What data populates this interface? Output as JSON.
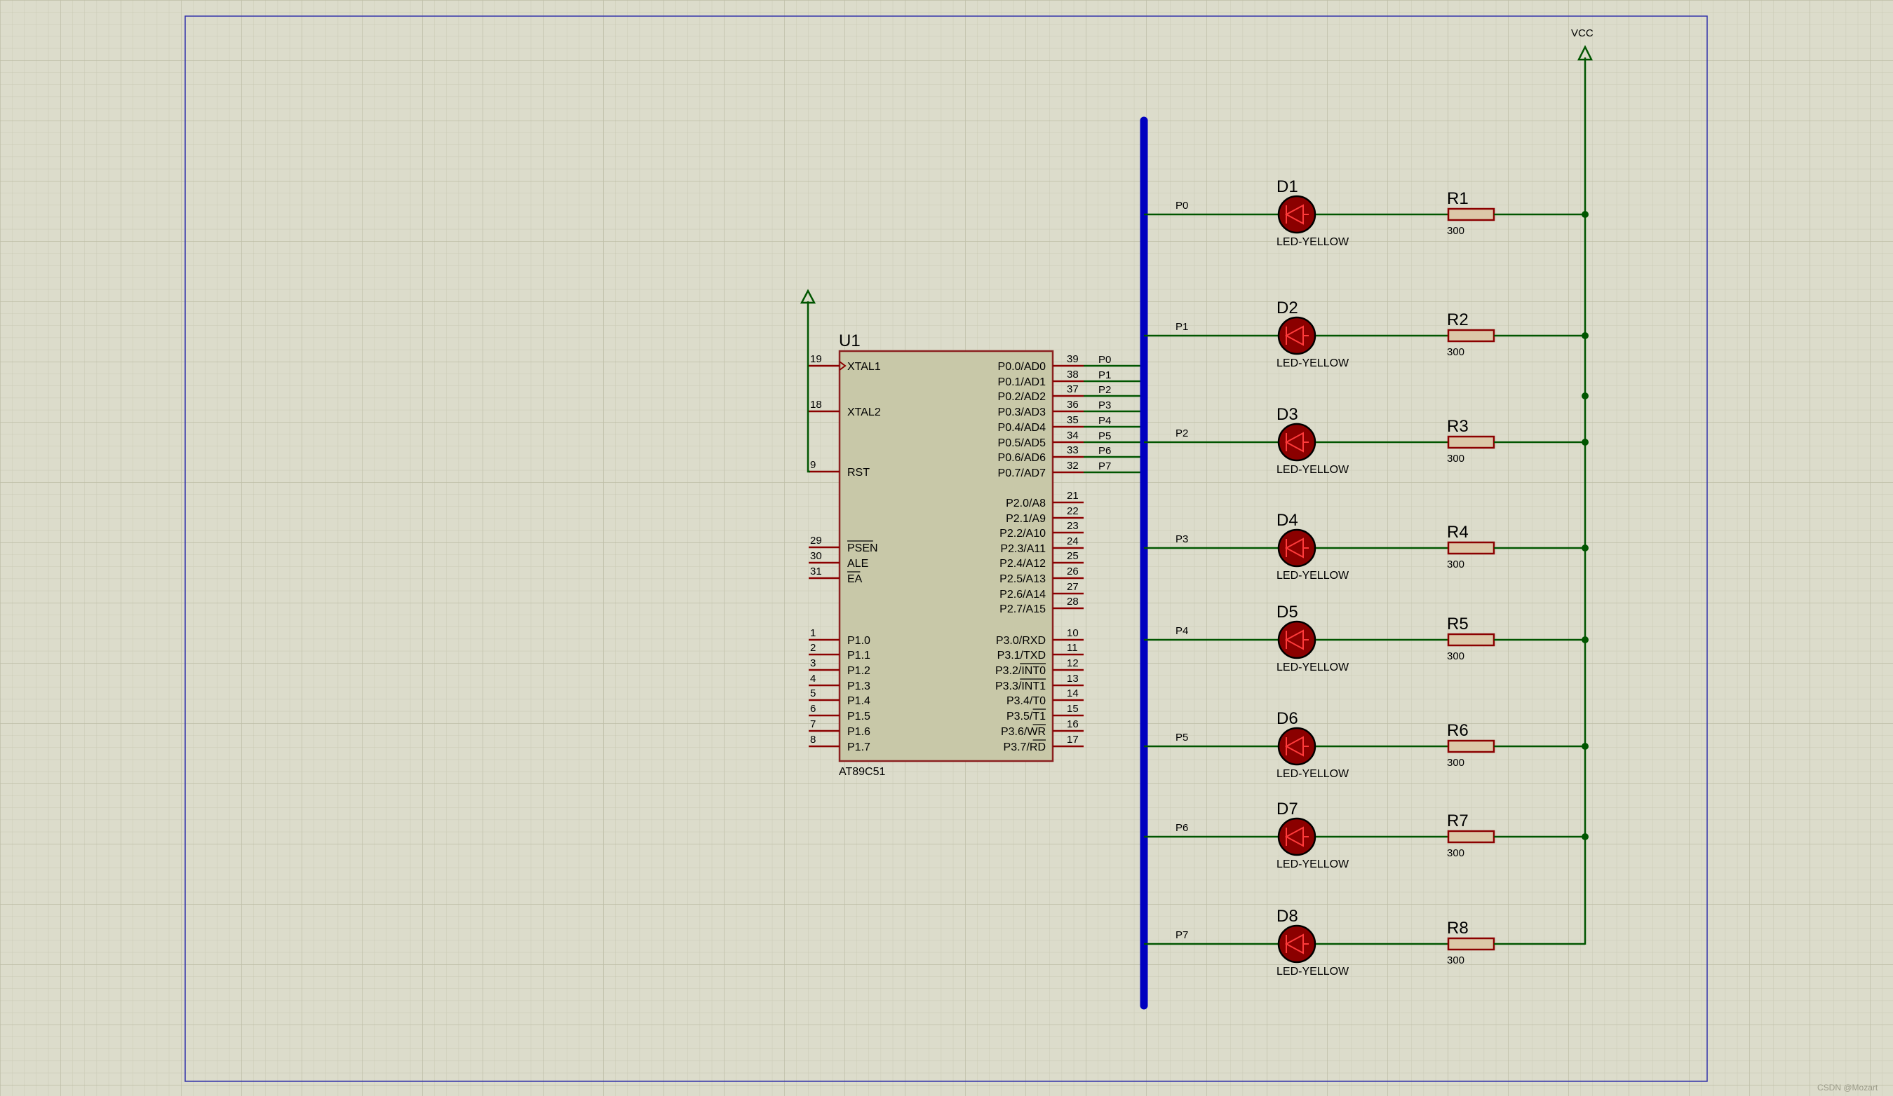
{
  "watermark": "CSDN @Mozart",
  "power": {
    "vcc_label": "VCC"
  },
  "mcu": {
    "ref": "U1",
    "part": "AT89C51",
    "left_pins": [
      {
        "num": "19",
        "name": "XTAL1"
      },
      {
        "num": "18",
        "name": "XTAL2"
      },
      {
        "num": "9",
        "name": "RST"
      },
      {
        "num": "29",
        "name": "PSEN"
      },
      {
        "num": "30",
        "name": "ALE"
      },
      {
        "num": "31",
        "name": "EA"
      },
      {
        "num": "1",
        "name": "P1.0"
      },
      {
        "num": "2",
        "name": "P1.1"
      },
      {
        "num": "3",
        "name": "P1.2"
      },
      {
        "num": "4",
        "name": "P1.3"
      },
      {
        "num": "5",
        "name": "P1.4"
      },
      {
        "num": "6",
        "name": "P1.5"
      },
      {
        "num": "7",
        "name": "P1.6"
      },
      {
        "num": "8",
        "name": "P1.7"
      }
    ],
    "right_pins": [
      {
        "num": "39",
        "name": "P0.0/AD0",
        "net": "P0"
      },
      {
        "num": "38",
        "name": "P0.1/AD1",
        "net": "P1"
      },
      {
        "num": "37",
        "name": "P0.2/AD2",
        "net": "P2"
      },
      {
        "num": "36",
        "name": "P0.3/AD3",
        "net": "P3"
      },
      {
        "num": "35",
        "name": "P0.4/AD4",
        "net": "P4"
      },
      {
        "num": "34",
        "name": "P0.5/AD5",
        "net": "P5"
      },
      {
        "num": "33",
        "name": "P0.6/AD6",
        "net": "P6"
      },
      {
        "num": "32",
        "name": "P0.7/AD7",
        "net": "P7"
      },
      {
        "num": "21",
        "name": "P2.0/A8"
      },
      {
        "num": "22",
        "name": "P2.1/A9"
      },
      {
        "num": "23",
        "name": "P2.2/A10"
      },
      {
        "num": "24",
        "name": "P2.3/A11"
      },
      {
        "num": "25",
        "name": "P2.4/A12"
      },
      {
        "num": "26",
        "name": "P2.5/A13"
      },
      {
        "num": "27",
        "name": "P2.6/A14"
      },
      {
        "num": "28",
        "name": "P2.7/A15"
      },
      {
        "num": "10",
        "name": "P3.0/RXD"
      },
      {
        "num": "11",
        "name": "P3.1/TXD"
      },
      {
        "num": "12",
        "name": "P3.2/INT0"
      },
      {
        "num": "13",
        "name": "P3.3/INT1"
      },
      {
        "num": "14",
        "name": "P3.4/T0"
      },
      {
        "num": "15",
        "name": "P3.5/T1"
      },
      {
        "num": "16",
        "name": "P3.6/WR"
      },
      {
        "num": "17",
        "name": "P3.7/RD"
      }
    ]
  },
  "channels": [
    {
      "net": "P0",
      "led_ref": "D1",
      "led_type": "LED-YELLOW",
      "res_ref": "R1",
      "res_value": "300"
    },
    {
      "net": "P1",
      "led_ref": "D2",
      "led_type": "LED-YELLOW",
      "res_ref": "R2",
      "res_value": "300"
    },
    {
      "net": "P2",
      "led_ref": "D3",
      "led_type": "LED-YELLOW",
      "res_ref": "R3",
      "res_value": "300"
    },
    {
      "net": "P3",
      "led_ref": "D4",
      "led_type": "LED-YELLOW",
      "res_ref": "R4",
      "res_value": "300"
    },
    {
      "net": "P4",
      "led_ref": "D5",
      "led_type": "LED-YELLOW",
      "res_ref": "R5",
      "res_value": "300"
    },
    {
      "net": "P5",
      "led_ref": "D6",
      "led_type": "LED-YELLOW",
      "res_ref": "R6",
      "res_value": "300"
    },
    {
      "net": "P6",
      "led_ref": "D7",
      "led_type": "LED-YELLOW",
      "res_ref": "R7",
      "res_value": "300"
    },
    {
      "net": "P7",
      "led_ref": "D8",
      "led_type": "LED-YELLOW",
      "res_ref": "R8",
      "res_value": "300"
    }
  ],
  "colors": {
    "background": "#dcdccb",
    "grid_minor": "#cacab6",
    "grid_major": "#bdbda6",
    "sheet_border": "#3333aa",
    "wire": "#005500",
    "bus": "#0000c0",
    "pin": "#8b0000",
    "chip_fill": "#c8c8a8",
    "chip_border": "#8b2020",
    "led_fill": "#8b0000",
    "resistor_fill": "#dcc8a8",
    "text": "#000000"
  }
}
